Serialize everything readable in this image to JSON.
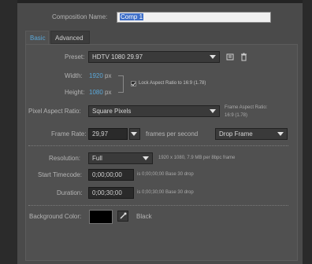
{
  "dialog": {
    "comp_name_label": "Composition Name:",
    "comp_name_value": "Comp 1"
  },
  "tabs": [
    {
      "label": "Basic",
      "active": true
    },
    {
      "label": "Advanced",
      "active": false
    }
  ],
  "basic": {
    "preset_label": "Preset:",
    "preset_value": "HDTV 1080 29.97",
    "width_label": "Width:",
    "width_value": "1920",
    "width_unit": "px",
    "height_label": "Height:",
    "height_value": "1080",
    "height_unit": "px",
    "lock_aspect_label": "Lock Aspect Ratio to 16:9 (1.78)",
    "lock_aspect_checked": true,
    "pixel_aspect_label": "Pixel Aspect Ratio:",
    "pixel_aspect_value": "Square Pixels",
    "frame_aspect_label": "Frame Aspect Ratio:",
    "frame_aspect_value": "16:9 (1.78)",
    "frame_rate_label": "Frame Rate:",
    "frame_rate_value": "29,97",
    "frame_rate_unit": "frames per second",
    "drop_frame_value": "Drop Frame",
    "resolution_label": "Resolution:",
    "resolution_value": "Full",
    "resolution_info": "1920 x 1080, 7.9 MB per 8bpc frame",
    "start_timecode_label": "Start Timecode:",
    "start_timecode_value": "0;00;00;00",
    "start_timecode_info": "is 0;00;00;00  Base 30  drop",
    "duration_label": "Duration:",
    "duration_value": "0;00;30;00",
    "duration_info": "is 0;00;30;00  Base 30  drop",
    "bg_color_label": "Background Color:",
    "bg_color_name": "Black",
    "bg_color_hex": "#000000"
  },
  "colors": {
    "accent": "#5aa7d8",
    "panel": "#505050",
    "dialog": "#4a4a4a"
  }
}
